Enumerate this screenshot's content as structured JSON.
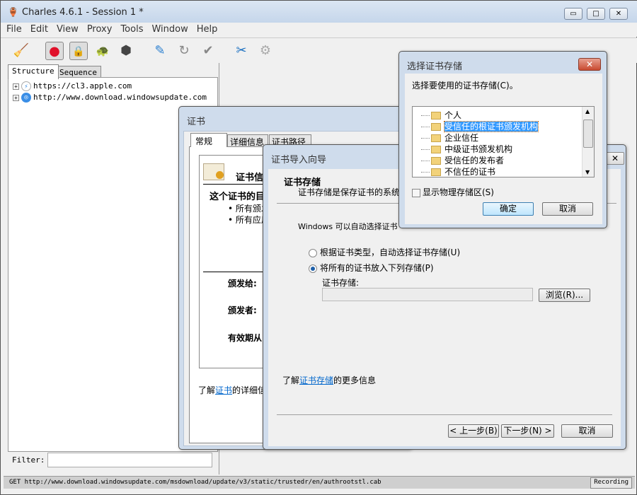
{
  "window": {
    "title": "Charles 4.6.1 - Session 1 *",
    "minimize": "▭",
    "maximize": "□",
    "close": "✕"
  },
  "menu": [
    "File",
    "Edit",
    "View",
    "Proxy",
    "Tools",
    "Window",
    "Help"
  ],
  "toolbar": [
    {
      "icon": "broom-icon",
      "glyph": "🧹"
    },
    {
      "icon": "record-icon",
      "glyph": "●"
    },
    {
      "icon": "ssl-lock-icon",
      "glyph": "🔒"
    },
    {
      "icon": "turtle-throttle-icon",
      "glyph": "🐢"
    },
    {
      "icon": "stop-hexagon-icon",
      "glyph": "⬢"
    },
    {
      "icon": "pen-compose-icon",
      "glyph": "✎"
    },
    {
      "icon": "repeat-icon",
      "glyph": "↻"
    },
    {
      "icon": "validate-check-icon",
      "glyph": "✔"
    },
    {
      "icon": "tools-icon",
      "glyph": "✂"
    },
    {
      "icon": "settings-gear-icon",
      "glyph": "⚙"
    }
  ],
  "left": {
    "tabs": [
      "Structure",
      "Sequence"
    ],
    "tree": [
      "https://cl3.apple.com",
      "http://www.download.windowsupdate.com"
    ],
    "filter_label": "Filter:",
    "filter_value": ""
  },
  "status": {
    "text": "GET http://www.download.windowsupdate.com/msdownload/update/v3/static/trustedr/en/authrootstl.cab",
    "recording": "Recording"
  },
  "cert": {
    "title": "证书",
    "tabs": [
      "常规",
      "详细信息",
      "证书路径"
    ],
    "info_title": "证书信",
    "purpose_title": "这个证书的目",
    "bullets": [
      "所有颁发",
      "所有应用"
    ],
    "issued_to": "颁发给:",
    "issued_by": "颁发者:",
    "valid": "有效期从",
    "learn_prefix": "了解",
    "learn_link": "证书",
    "learn_suffix": "的详细信"
  },
  "wizard": {
    "title": "证书导入向导",
    "heading": "证书存储",
    "subheading": "证书存储是保存证书的系统",
    "desc": "Windows 可以自动选择证书",
    "radio_auto": "根据证书类型，自动选择证书存储(U)",
    "radio_manual": "将所有的证书放入下列存储(P)",
    "radio_selected": "manual",
    "store_label": "证书存储:",
    "store_value": "",
    "browse": "浏览(R)...",
    "learn_prefix": "了解",
    "learn_link": "证书存储",
    "learn_suffix": "的更多信息",
    "back": "< 上一步(B)",
    "next": "下一步(N) >",
    "cancel": "取消"
  },
  "store_dialog": {
    "title": "选择证书存储",
    "prompt": "选择要使用的证书存储(C)。",
    "items": [
      "个人",
      "受信任的根证书颁发机构",
      "企业信任",
      "中级证书颁发机构",
      "受信任的发布者",
      "不信任的证书"
    ],
    "selected": "受信任的根证书颁发机构",
    "show_physical": "显示物理存储区(S)",
    "show_physical_checked": false,
    "ok": "确定",
    "cancel": "取消"
  }
}
